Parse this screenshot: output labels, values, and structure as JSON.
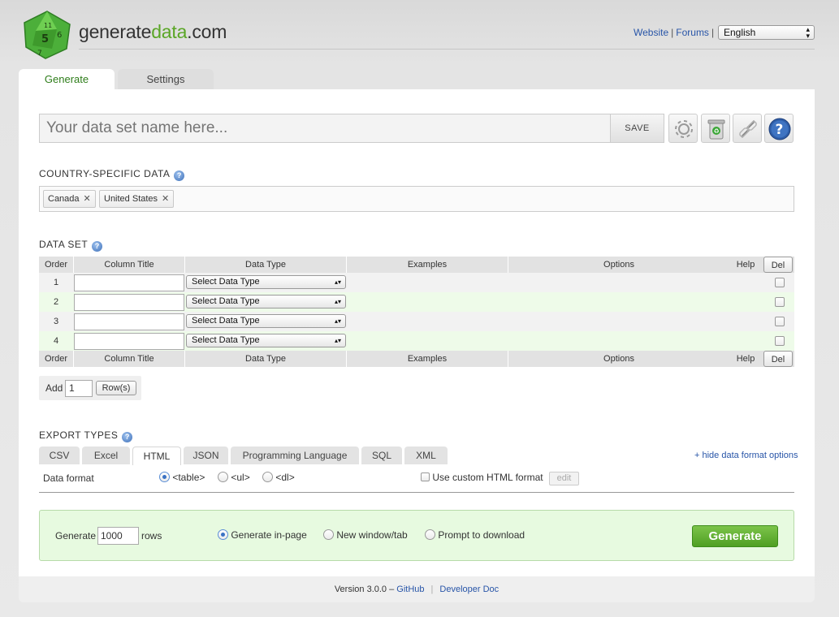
{
  "header": {
    "logo_part1": "generate",
    "logo_part2": "data",
    "logo_part3": ".com",
    "logo_die_numbers": [
      "5",
      "11",
      "6",
      "7"
    ],
    "links": {
      "website": "Website",
      "forums": "Forums",
      "separator": "|"
    },
    "language": "English"
  },
  "tabs": {
    "generate": "Generate",
    "settings": "Settings"
  },
  "dataset_name": {
    "placeholder": "Your data set name here...",
    "save_label": "SAVE"
  },
  "country": {
    "heading": "COUNTRY-SPECIFIC DATA",
    "chips": [
      "Canada",
      "United States"
    ]
  },
  "data_set": {
    "heading": "DATA SET",
    "columns": [
      "Order",
      "Column Title",
      "Data Type",
      "Examples",
      "Options",
      "Help"
    ],
    "del_label": "Del",
    "rows": [
      {
        "order": "1",
        "type": "Select Data Type"
      },
      {
        "order": "2",
        "type": "Select Data Type"
      },
      {
        "order": "3",
        "type": "Select Data Type"
      },
      {
        "order": "4",
        "type": "Select Data Type"
      }
    ],
    "add_label": "Add",
    "add_value": "1",
    "rows_button": "Row(s)"
  },
  "export": {
    "heading": "EXPORT TYPES",
    "tabs": [
      "CSV",
      "Excel",
      "HTML",
      "JSON",
      "Programming Language",
      "SQL",
      "XML"
    ],
    "active_tab": "HTML",
    "hide_link": "+ hide data format options",
    "format_label": "Data format",
    "format_options": [
      "<table>",
      "<ul>",
      "<dl>"
    ],
    "custom_label": "Use custom HTML format",
    "edit_label": "edit"
  },
  "generate": {
    "label": "Generate",
    "rows_value": "1000",
    "rows_label": "rows",
    "options": [
      "Generate in-page",
      "New window/tab",
      "Prompt to download"
    ],
    "button": "Generate"
  },
  "footer": {
    "version": "Version 3.0.0 – ",
    "github": "GitHub",
    "sep": "|",
    "devdoc": "Developer Doc"
  },
  "colors": {
    "accent_green": "#5aa626",
    "link_blue": "#2855a8",
    "row_green": "#eefbe9"
  }
}
